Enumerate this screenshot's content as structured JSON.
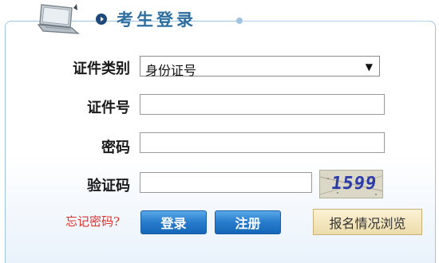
{
  "header": {
    "title": "考生登录"
  },
  "form": {
    "id_type_label": "证件类别",
    "id_type_value": "身份证号",
    "id_number_label": "证件号",
    "password_label": "密码",
    "captcha_label": "验证码",
    "captcha_text": "1599"
  },
  "actions": {
    "forgot_password": "忘记密码?",
    "login": "登录",
    "register": "注册",
    "browse_registration": "报名情况浏览"
  },
  "colors": {
    "accent": "#2f6e9f",
    "button": "#2b7fcf",
    "forgot": "#e0302a"
  }
}
